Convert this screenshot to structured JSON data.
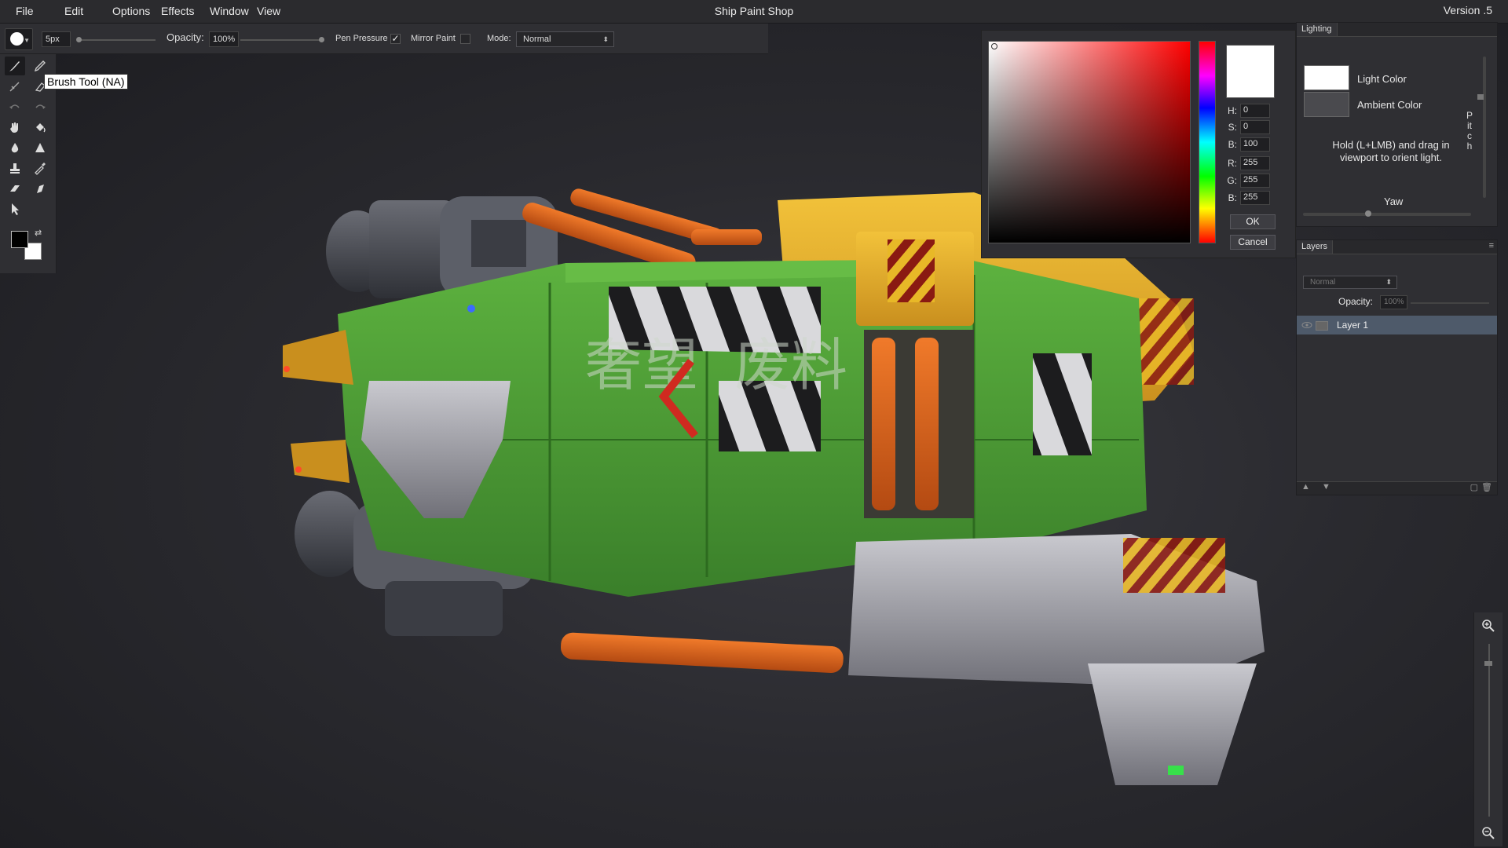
{
  "menubar": {
    "items": [
      "File",
      "Edit",
      "Options",
      "Effects",
      "Window",
      "View"
    ],
    "app_title": "Ship Paint Shop",
    "version": "Version .5"
  },
  "options": {
    "brush_size": "5px",
    "opacity_label": "Opacity:",
    "opacity_value": "100%",
    "pen_pressure_label": "Pen Pressure",
    "pen_pressure_checked": "✓",
    "mirror_paint_label": "Mirror Paint",
    "mode_label": "Mode:",
    "mode_value": "Normal"
  },
  "toolbox": {
    "tooltip": "Brush Tool (NA)",
    "foreground_color": "#000000",
    "background_color": "#ffffff"
  },
  "color_picker": {
    "h_label": "H:",
    "h_value": "0",
    "s_label": "S:",
    "s_value": "0",
    "b_label": "B:",
    "b_value": "100",
    "r_label": "R:",
    "r_value": "255",
    "g_label": "G:",
    "g_value": "255",
    "b2_label": "B:",
    "b2_value": "255",
    "ok_label": "OK",
    "cancel_label": "Cancel"
  },
  "lighting": {
    "tab": "Lighting",
    "light_color_label": "Light Color",
    "ambient_color_label": "Ambient Color",
    "hint": "Hold (L+LMB) and drag in viewport to orient light.",
    "pitch_label": "Pitch",
    "yaw_label": "Yaw"
  },
  "layers": {
    "tab": "Layers",
    "blend_mode": "Normal",
    "opacity_label": "Opacity:",
    "opacity_value": "100%",
    "items": [
      {
        "name": "Layer 1"
      }
    ]
  },
  "viewport": {
    "hull_text_left": "奢望",
    "hull_text_right": "废料"
  },
  "colors": {
    "accent_green": "#4a9a34",
    "accent_yellow": "#e9b32a",
    "accent_orange": "#d8621c",
    "selection": "#4e5a6a"
  }
}
